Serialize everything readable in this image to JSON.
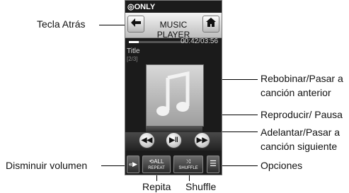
{
  "phone": {
    "status_text": "ONLY",
    "title": "MUSIC PLAYER",
    "back_icon": "arrow-left",
    "home_icon": "home",
    "time": "00:42/03:56",
    "progress": 0.178,
    "song_title": "Title",
    "track_count": "[2/3]",
    "album_icon": "music-note",
    "controls": {
      "rewind_icon": "rewind",
      "play_pause_icon": "play-pause",
      "forward_icon": "fast-forward"
    },
    "bottom": {
      "volume_icon": "volume",
      "repeat_icon_text": "ALL",
      "repeat_label": "REPEAT",
      "shuffle_label": "SHUFFLE",
      "options_icon": "menu"
    }
  },
  "callouts": {
    "back_key": "Tecla Atrás",
    "rewind_line1": "Rebobinar/Pasar a",
    "rewind_line2": "canción anterior",
    "play_pause": "Reproducir/ Pausa",
    "forward_line1": "Adelantar/Pasar a",
    "forward_line2": "canción siguiente",
    "volume_down": "Disminuir volumen",
    "options": "Opciones",
    "repeat": "Repita",
    "shuffle": "Shuffle"
  }
}
